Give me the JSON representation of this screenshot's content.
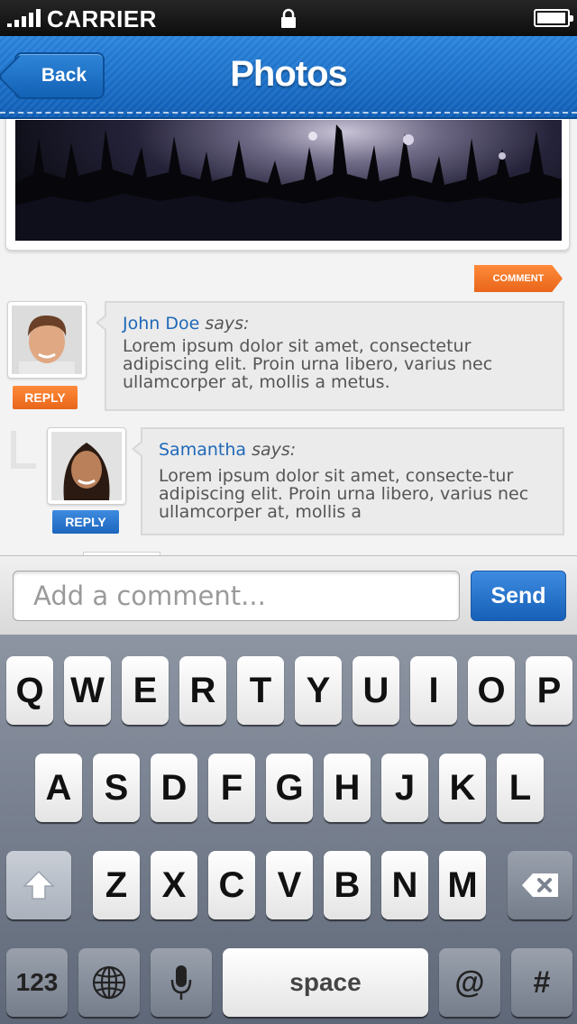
{
  "status_bar": {
    "carrier": "CARRIER"
  },
  "nav": {
    "back_label": "Back",
    "title": "Photos"
  },
  "post": {
    "comment_label": "COMMENT"
  },
  "comments": [
    {
      "author": "John Doe",
      "says": "says:",
      "text": "Lorem ipsum dolor sit amet, consectetur adipiscing elit. Proin urna libero, varius nec ullamcorper at, mollis a metus.",
      "reply_label": "REPLY"
    },
    {
      "author": "Samantha",
      "says": "says:",
      "text": "Lorem ipsum dolor sit amet, consecte-tur adipiscing elit. Proin urna libero, varius nec ullamcorper at, mollis a",
      "reply_label": "REPLY"
    }
  ],
  "input": {
    "placeholder": "Add a comment...",
    "send_label": "Send"
  },
  "keyboard": {
    "row1": [
      "Q",
      "W",
      "E",
      "R",
      "T",
      "Y",
      "U",
      "I",
      "O",
      "P"
    ],
    "row2": [
      "A",
      "S",
      "D",
      "F",
      "G",
      "H",
      "J",
      "K",
      "L"
    ],
    "row3": [
      "Z",
      "X",
      "C",
      "V",
      "B",
      "N",
      "M"
    ],
    "numbers_label": "123",
    "space_label": "space",
    "at_label": "@",
    "hash_label": "#"
  },
  "colors": {
    "nav_blue": "#1a6fce",
    "accent_orange": "#f27426",
    "link_blue": "#1f68b8"
  }
}
